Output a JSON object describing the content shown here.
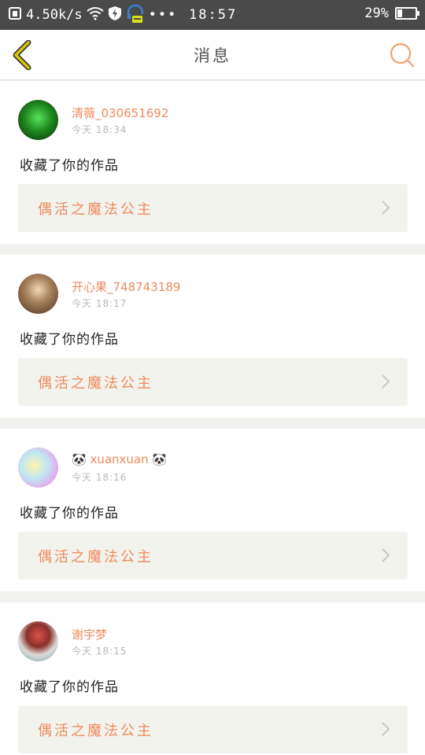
{
  "status_bar": {
    "speed": "4.50k/s",
    "time": "18:57",
    "battery": "29%",
    "battery_level": 0.29,
    "icons": [
      "notification-icon",
      "wifi-icon",
      "shield-icon",
      "headset-icon",
      "more-dots-icon"
    ]
  },
  "header": {
    "title": "消息",
    "back_icon": "chevron-left-icon",
    "search_icon": "search-icon"
  },
  "colors": {
    "accent": "#f08a5d",
    "back": "#c8b400",
    "card_bg": "#f3f3ed"
  },
  "messages": [
    {
      "username": "清薇_030651692",
      "time": "今天 18:34",
      "action": "收藏了你的作品",
      "work_title": "偶活之魔法公主",
      "avatar_color": "#1f6b1f"
    },
    {
      "username": "开心果_748743189",
      "time": "今天 18:17",
      "action": "收藏了你的作品",
      "work_title": "偶活之魔法公主",
      "avatar_color": "#7a5a3a"
    },
    {
      "username": "xuanxuan",
      "time": "今天 18:16",
      "action": "收藏了你的作品",
      "work_title": "偶活之魔法公主",
      "avatar_color": "#9ed8e6"
    },
    {
      "username": "谢宇梦",
      "time": "今天 18:15",
      "action": "收藏了你的作品",
      "work_title": "偶活之魔法公主",
      "avatar_color": "#c9574a"
    }
  ]
}
